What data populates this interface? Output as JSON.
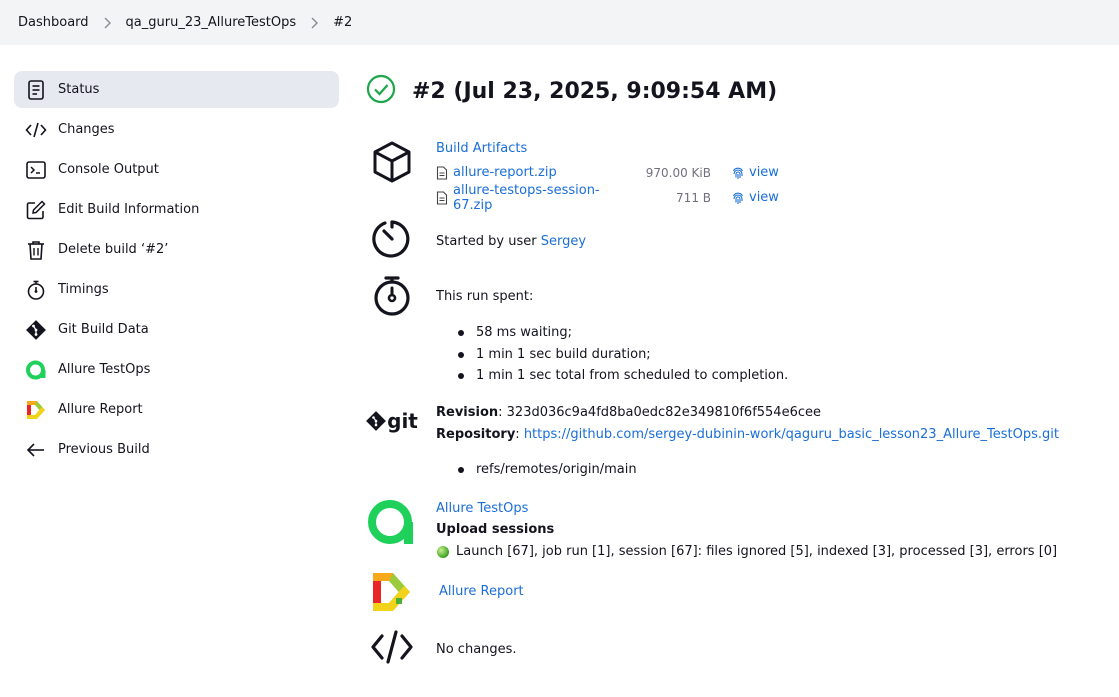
{
  "breadcrumb": {
    "items": [
      "Dashboard",
      "qa_guru_23_AllureTestOps",
      "#2"
    ]
  },
  "sidebar": {
    "items": [
      {
        "label": "Status",
        "icon": "document-icon"
      },
      {
        "label": "Changes",
        "icon": "code-icon"
      },
      {
        "label": "Console Output",
        "icon": "terminal-icon"
      },
      {
        "label": "Edit Build Information",
        "icon": "edit-icon"
      },
      {
        "label": "Delete build ‘#2’",
        "icon": "trash-icon"
      },
      {
        "label": "Timings",
        "icon": "stopwatch-icon"
      },
      {
        "label": "Git Build Data",
        "icon": "git-icon"
      },
      {
        "label": "Allure TestOps",
        "icon": "allure-testops-icon"
      },
      {
        "label": "Allure Report",
        "icon": "allure-report-icon"
      },
      {
        "label": "Previous Build",
        "icon": "arrow-left-icon"
      }
    ]
  },
  "build": {
    "title": "#2 (Jul 23, 2025, 9:09:54 AM)",
    "status_color": "#1ea64b"
  },
  "artifacts": {
    "heading": "Build Artifacts",
    "files": [
      {
        "name": "allure-report.zip",
        "size": "970.00 KiB",
        "view": "view"
      },
      {
        "name": "allure-testops-session-67.zip",
        "size": "711 B",
        "view": "view"
      }
    ]
  },
  "cause": {
    "prefix": "Started by user ",
    "user": "Sergey"
  },
  "timing": {
    "heading": "This run spent:",
    "items": [
      "58 ms waiting;",
      "1 min 1 sec build duration;",
      "1 min 1 sec total from scheduled to completion."
    ]
  },
  "git": {
    "logo_text": "git",
    "revision_label": "Revision",
    "revision": "323d036c9a4fd8ba0edc82e349810f6f554e6cee",
    "repository_label": "Repository",
    "repository": "https://github.com/sergey-dubinin-work/qaguru_basic_lesson23_Allure_TestOps.git",
    "refs": [
      "refs/remotes/origin/main"
    ]
  },
  "testops": {
    "link": "Allure TestOps",
    "heading": "Upload sessions",
    "session": "Launch [67], job run [1], session [67]: files ignored [5], indexed [3], processed [3], errors [0]"
  },
  "allure_report": {
    "link": "Allure Report"
  },
  "changes": {
    "text": "No changes."
  },
  "colors": {
    "accent": "#1a6ed8",
    "success": "#1ea64b",
    "testops_green": "#1fd15a"
  }
}
